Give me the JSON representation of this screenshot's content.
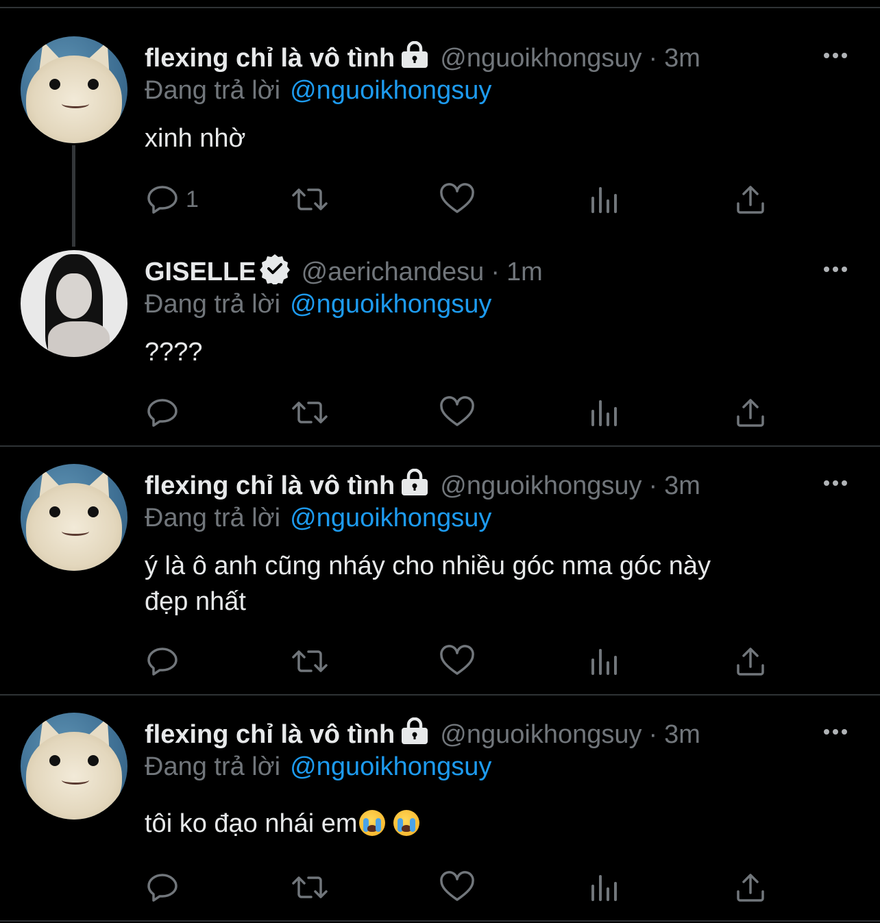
{
  "tweets": [
    {
      "display_name": "flexing chỉ là vô tình",
      "locked": true,
      "verified": false,
      "handle": "@nguoikhongsuy",
      "separator": "·",
      "time": "3m",
      "reply_label": "Đang trả lời",
      "reply_to": "@nguoikhongsuy",
      "text": "xinh nhờ",
      "reply_count": "1",
      "avatar": "cat-avatar"
    },
    {
      "display_name": "GISELLE",
      "locked": false,
      "verified": true,
      "handle": "@aerichandesu",
      "separator": "·",
      "time": "1m",
      "reply_label": "Đang trả lời",
      "reply_to": "@nguoikhongsuy",
      "text": "????",
      "reply_count": "",
      "avatar": "girl-avatar"
    },
    {
      "display_name": "flexing chỉ là vô tình",
      "locked": true,
      "verified": false,
      "handle": "@nguoikhongsuy",
      "separator": "·",
      "time": "3m",
      "reply_label": "Đang trả lời",
      "reply_to": "@nguoikhongsuy",
      "text_line1": "ý là ô anh cũng nháy cho nhiều góc nma góc này",
      "text_line2": "đẹp nhất",
      "reply_count": "",
      "avatar": "cat-avatar"
    },
    {
      "display_name": "flexing chỉ là vô tình",
      "locked": true,
      "verified": false,
      "handle": "@nguoikhongsuy",
      "separator": "·",
      "time": "3m",
      "reply_label": "Đang trả lời",
      "reply_to": "@nguoikhongsuy",
      "text": "tôi ko đạo nhái em",
      "emoji": "loudly-crying-face",
      "reply_count": "",
      "avatar": "cat-avatar"
    }
  ],
  "colors": {
    "background": "#000000",
    "text": "#e7e9ea",
    "muted": "#71767b",
    "link": "#1d9bf0",
    "divider": "#2f3336"
  },
  "icons": [
    "lock-icon",
    "verified-icon",
    "more-icon",
    "reply-icon",
    "retweet-icon",
    "like-icon",
    "views-icon",
    "share-icon"
  ]
}
